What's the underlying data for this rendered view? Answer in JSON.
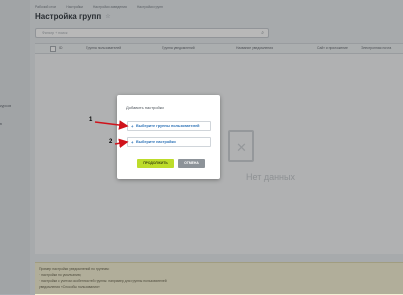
{
  "breadcrumb": [
    "Рабочий стол",
    "Настройки",
    "Настройки заведения",
    "Настройки групп"
  ],
  "title": "Настройка групп",
  "filter": {
    "placeholder": "Фильтр + поиск"
  },
  "left_nav": [
    "курсов",
    "в"
  ],
  "table": {
    "columns": [
      "ID",
      "Группа пользователей",
      "Группа уведомлений",
      "Название уведомления",
      "Сайт и приложение",
      "Электронная почта"
    ],
    "empty_text": "Нет данных"
  },
  "note": {
    "lines": [
      "Пример настройки уведомлений по группам:",
      "· настройки по умолчанию;",
      "· настройки с учетом особенностей группы: например для группы пользователей",
      "  уведомления «Способы пользования»"
    ]
  },
  "dialog": {
    "title": "Добавить настройки",
    "option_users": "Выберите группы пользователей",
    "option_settings": "Выберите настройки",
    "continue": "ПРОДОЛЖИТЬ",
    "cancel": "ОТМЕНА"
  },
  "markers": [
    "1",
    "2"
  ],
  "colors": {
    "accent": "#2f74b8",
    "arrow": "#d0121b",
    "continue": "#bddc2b"
  }
}
